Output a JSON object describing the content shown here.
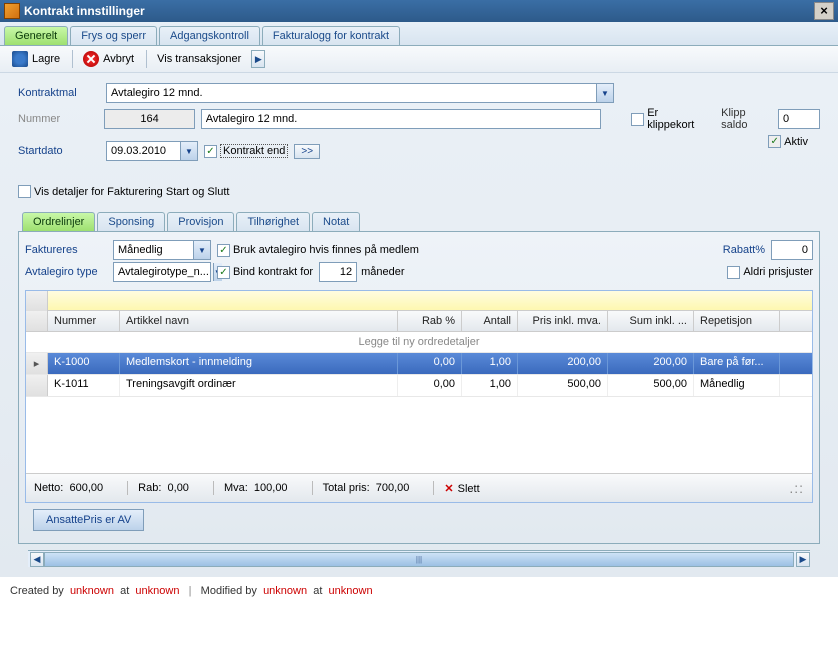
{
  "window": {
    "title": "Kontrakt innstillinger"
  },
  "mainTabs": {
    "generelt": "Generelt",
    "frys": "Frys og sperr",
    "adgang": "Adgangskontroll",
    "faktura": "Fakturalogg for kontrakt"
  },
  "toolbar": {
    "save": "Lagre",
    "cancel": "Avbryt",
    "trans": "Vis transaksjoner"
  },
  "form": {
    "aktiv_label": "Aktiv",
    "kontraktmal_label": "Kontraktmal",
    "kontraktmal_value": "Avtalegiro 12 mnd.",
    "nummer_label": "Nummer",
    "nummer_value": "164",
    "navn_value": "Avtalegiro 12 mnd.",
    "erklippekort_label": "Er klippekort",
    "klippsaldo_label": "Klipp saldo",
    "klippsaldo_value": "0",
    "startdato_label": "Startdato",
    "startdato_value": "09.03.2010",
    "kontrakt_end_label": "Kontrakt end",
    "visdetaljer_label": "Vis detaljer for Fakturering Start og Slutt"
  },
  "subTabs": {
    "ordrelinjer": "Ordrelinjer",
    "sponsing": "Sponsing",
    "provisjon": "Provisjon",
    "tilhorighet": "Tilhørighet",
    "notat": "Notat"
  },
  "subForm": {
    "faktureres_label": "Faktureres",
    "faktureres_value": "Månedlig",
    "bruk_avtalegiro": "Bruk avtalegiro hvis finnes på medlem",
    "rabatt_label": "Rabatt%",
    "rabatt_value": "0",
    "avtalegirotype_label": "Avtalegiro type",
    "avtalegirotype_value": "Avtalegirotype_n...",
    "bind_label": "Bind kontrakt for",
    "bind_value": "12",
    "maneder": "måneder",
    "aldri_prisjuster": "Aldri prisjuster"
  },
  "grid": {
    "headers": {
      "nummer": "Nummer",
      "navn": "Artikkel navn",
      "rab": "Rab %",
      "antall": "Antall",
      "pris": "Pris inkl. mva.",
      "sum": "Sum inkl. ...",
      "rep": "Repetisjon"
    },
    "newrow": "Legge til ny ordredetaljer",
    "rows": [
      {
        "num": "K-1000",
        "navn": "Medlemskort - innmelding",
        "rab": "0,00",
        "ant": "1,00",
        "pris": "200,00",
        "sum": "200,00",
        "rep": "Bare på før..."
      },
      {
        "num": "K-1011",
        "navn": "Treningsavgift ordinær",
        "rab": "0,00",
        "ant": "1,00",
        "pris": "500,00",
        "sum": "500,00",
        "rep": "Månedlig"
      }
    ]
  },
  "totals": {
    "netto_label": "Netto:",
    "netto_value": "600,00",
    "rab_label": "Rab:",
    "rab_value": "0,00",
    "mva_label": "Mva:",
    "mva_value": "100,00",
    "total_label": "Total pris:",
    "total_value": "700,00",
    "slett": "Slett"
  },
  "ansattePris": "AnsattePris er AV",
  "footer": {
    "created_by": "Created by",
    "unknown1": "unknown",
    "at1": "at",
    "unknown2": "unknown",
    "sep": "|",
    "modified_by": "Modified by",
    "unknown3": "unknown",
    "at2": "at",
    "unknown4": "unknown"
  }
}
